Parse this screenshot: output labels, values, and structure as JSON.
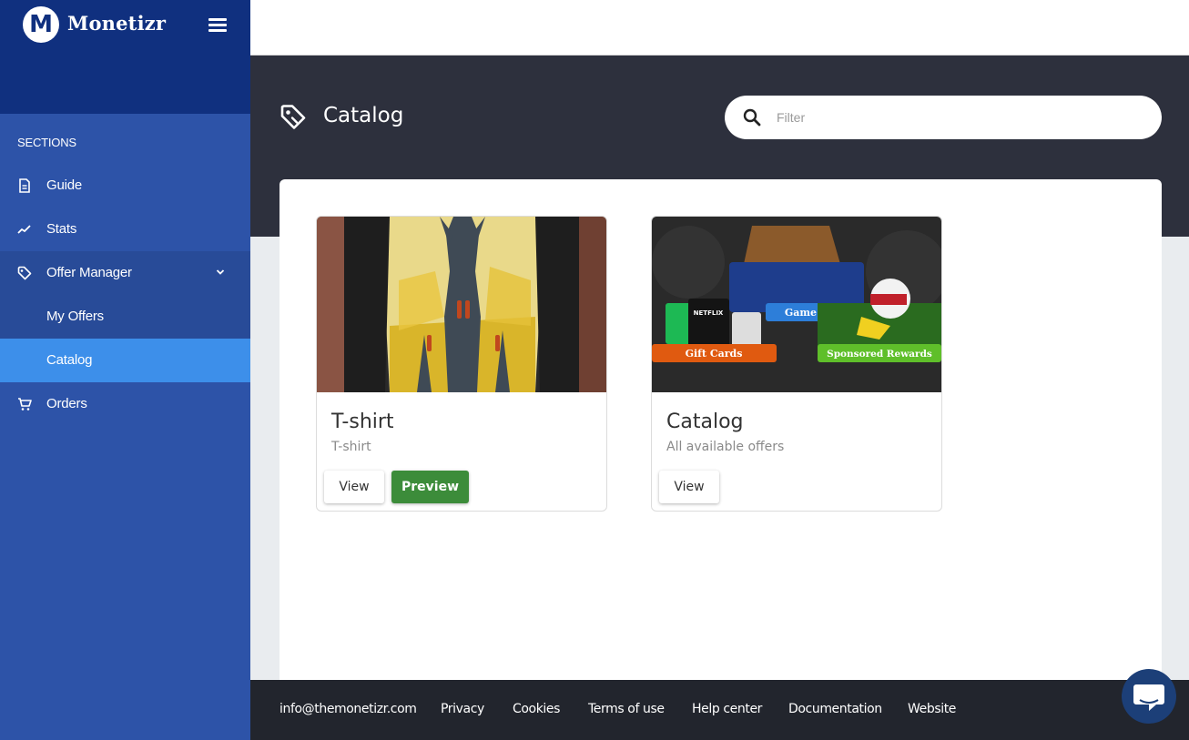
{
  "brand": {
    "logo_letter": "M",
    "name": "Monetizr"
  },
  "sidebar": {
    "section_label": "SECTIONS",
    "items": [
      {
        "label": "Guide",
        "icon": "document-icon"
      },
      {
        "label": "Stats",
        "icon": "trend-icon"
      },
      {
        "label": "Offer Manager",
        "icon": "tag-icon",
        "expanded": true
      },
      {
        "label": "My Offers",
        "sub": true
      },
      {
        "label": "Catalog",
        "sub": true,
        "active": true
      },
      {
        "label": "Orders",
        "icon": "cart-icon"
      }
    ]
  },
  "header": {
    "title": "Catalog",
    "search": {
      "placeholder": "Filter",
      "value": ""
    }
  },
  "offers": [
    {
      "title": "T-shirt",
      "subtitle": "T-shirt",
      "view_label": "View",
      "preview_label": "Preview"
    },
    {
      "title": "Catalog",
      "subtitle": "All available offers",
      "view_label": "View",
      "image_labels": {
        "gift_cards": "Gift Cards",
        "game_gear": "Game Gear",
        "sponsored": "Sponsored Rewards",
        "netflix": "NETFLIX"
      }
    }
  ],
  "footer": {
    "links": [
      "info@themonetizr.com",
      "Privacy",
      "Cookies",
      "Terms of use",
      "Help center",
      "Documentation",
      "Website"
    ]
  },
  "colors": {
    "sidebar": "#2d53a8",
    "sidebar_brand": "#10307f",
    "active_item": "#3d8fea",
    "header_band": "#2d303d",
    "preview_button": "#3c8c3a",
    "footer": "#22252d"
  }
}
